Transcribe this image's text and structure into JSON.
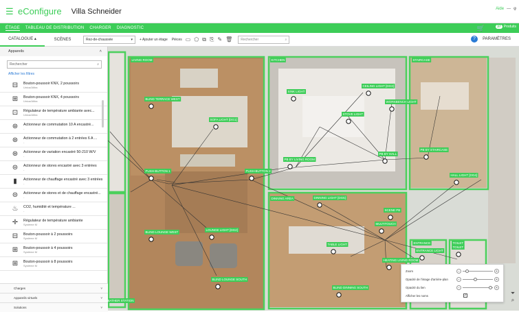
{
  "app": {
    "brand": "eConfigure",
    "project": "Villa Schneider",
    "top_right": [
      "Aide",
      "—",
      "φ"
    ]
  },
  "nav": {
    "tabs": [
      "ÉTAGE",
      "TABLEAU DE DISTRIBUTION",
      "CHARGER",
      "DIAGNOSTIC"
    ],
    "active": 0,
    "cart_count": "37",
    "produits": "Produits"
  },
  "toolbar": {
    "catalogue": "CATALOGUE",
    "scenes": "SCÈNES",
    "floor": "Rez-de-chaussée",
    "add_floor": "Ajouter un étage",
    "pieces": "Pièces",
    "search_placeholder": "Rechercher",
    "params": "PARAMÈTRES"
  },
  "sidebar": {
    "section": "Appareils",
    "search_placeholder": "Rechercher",
    "filters_link": "Afficher les filtres",
    "products": [
      {
        "name": "Bouton-poussoir KNX, 2 poussoirs",
        "sub": "Unica/Altira",
        "icon": "switch-2-icon"
      },
      {
        "name": "Bouton-poussoir KNX, 4 poussoirs",
        "sub": "Unica/Altira",
        "icon": "switch-4-icon"
      },
      {
        "name": "Régulateur de température ambiante avec...",
        "sub": "Unica/Altira",
        "icon": "thermostat-icon"
      },
      {
        "name": "Actionneur de commutation 10 A encastré...",
        "sub": "-",
        "icon": "actuator-icon"
      },
      {
        "name": "Actionneur de commutation à 2 entrées 6 A ...",
        "sub": "-",
        "icon": "actuator-icon"
      },
      {
        "name": "Actionneur de variation encastré 50-210 W/V",
        "sub": "-",
        "icon": "dimmer-icon"
      },
      {
        "name": "Actionneur de stores encastré avec 3 entrées",
        "sub": "-",
        "icon": "blind-actuator-icon"
      },
      {
        "name": "Actionneur de chauffage encastré avec 3 entrées",
        "sub": "-",
        "icon": "heating-actuator-icon"
      },
      {
        "name": "Actionneur de stores et de chauffage encastré...",
        "sub": "-",
        "icon": "blind-heating-icon"
      },
      {
        "name": "CO2, humidité et température ...",
        "sub": "-",
        "icon": "co2-sensor-icon"
      },
      {
        "name": "Régulateur de température ambiante",
        "sub": "Système M",
        "icon": "thermostat-m-icon"
      },
      {
        "name": "Bouton-poussoir à 2 poussoirs",
        "sub": "Système M",
        "icon": "switch-2-icon"
      },
      {
        "name": "Bouton-poussoir à 4 poussoirs",
        "sub": "Système M",
        "icon": "switch-4-icon"
      },
      {
        "name": "Bouton-poussoir à 8 poussoirs",
        "sub": "Système M",
        "icon": "switch-8-icon"
      }
    ],
    "footer": [
      "Charges",
      "Appareils virtuels",
      "Solutions"
    ]
  },
  "rooms": [
    "LIVING ROOM",
    "KITCHEN",
    "STAIRCASE",
    "DINNING AREA",
    "ENTRANCE",
    "TOILET",
    "BATHER STATION"
  ],
  "devices": [
    "BLIND TERRACE WEST",
    "SOFA LIGHT [DG1]",
    "PUSH-BUTTON 1",
    "PUSH-BUTTON 2",
    "BLIND LOUNGE WEST",
    "LOUNGE LIGHT [DG2]",
    "BLIND LOUNGE SOUTH",
    "SINK LIGHT",
    "CEILING LIGHT [DG3]",
    "WORKBENCH LIGHT",
    "STOVE LIGHT",
    "PB BY LIVING ROOM",
    "PB BY HALL",
    "PB BY STAIRCASE",
    "HALL LIGHT [DG4]",
    "DINNING LIGHT [DG5]",
    "SCENE PB",
    "MULTITOUCH",
    "TABLE LIGHT",
    "HEATING LIVING ROOM",
    "BLIND DINNING SOUTH",
    "ENTRANCE LIGHT",
    "TOILET"
  ],
  "panel": {
    "zoom": "Zoom",
    "opacity_bg": "Opacité de l'image d'arrière-plan",
    "opacity_link": "Opacité du lien",
    "show_names": "Afficher les noms",
    "zoom_level": 0.1,
    "bg_opacity": 0.4,
    "link_opacity": 0.9,
    "show_names_checked": true
  }
}
